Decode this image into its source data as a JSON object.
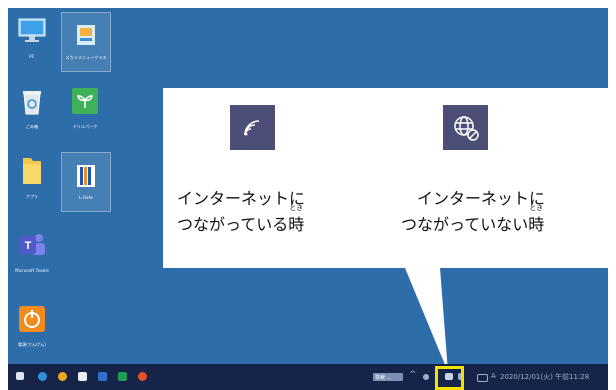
{
  "desktop_icons": [
    {
      "id": "pc",
      "label": "PC",
      "icon": "monitor-icon"
    },
    {
      "id": "sukaimenu",
      "label": "スカイメニュークラス",
      "icon": "skymenu-app-icon"
    },
    {
      "id": "recycle",
      "label": "ごみ箱",
      "icon": "recycle-bin-icon"
    },
    {
      "id": "dorilpark",
      "label": "ドリルパーク",
      "icon": "drill-park-icon"
    },
    {
      "id": "apps",
      "label": "アプリ",
      "icon": "folder-icon"
    },
    {
      "id": "lgate",
      "label": "L-Gate",
      "icon": "lgate-icon"
    },
    {
      "id": "teams",
      "label": "Microsoft Teams",
      "icon": "teams-icon"
    },
    {
      "id": "shutdown",
      "label": "電源(でんげん)",
      "icon": "power-icon"
    }
  ],
  "callout": {
    "connected": {
      "line1": "インターネットに",
      "line2_prefix": "つながっている",
      "time_kanji": "時",
      "ruby": "とき",
      "icon": "wifi-connected-icon"
    },
    "disconnected": {
      "line1": "インターネットに",
      "line2_prefix": "つながっていない",
      "time_kanji": "時",
      "ruby": "とき",
      "icon": "globe-no-connection-icon"
    }
  },
  "taskbar": {
    "search_chip": "検索 ...",
    "ime": "A",
    "datetime": "2020/12/01(火) 午前11:28",
    "apps": [
      "start",
      "edge",
      "chrome",
      "files",
      "word",
      "excel",
      "powerpoint"
    ]
  },
  "colors": {
    "desktop_bg": "#2d6eaa",
    "taskbar_bg": "#17244a",
    "status_tile": "#4d4e78",
    "highlight": "#f2e200"
  }
}
